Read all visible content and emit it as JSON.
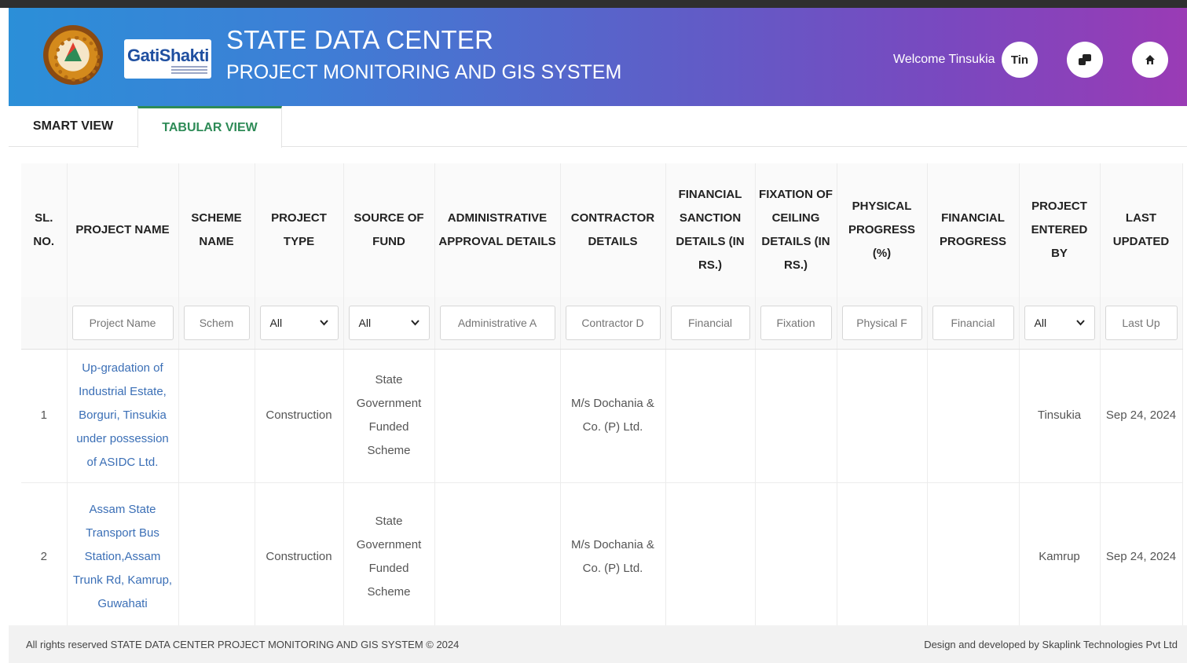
{
  "header": {
    "emblem_text": "ASIDC",
    "logo_text": "GatiShakti",
    "title": "STATE DATA CENTER",
    "subtitle": "PROJECT MONITORING AND GIS SYSTEM",
    "welcome": "Welcome Tinsukia",
    "avatar": "Tin",
    "icons": [
      "switch-icon",
      "home-icon"
    ]
  },
  "tabs": [
    {
      "label": "SMART VIEW",
      "active": false
    },
    {
      "label": "TABULAR VIEW",
      "active": true
    }
  ],
  "table": {
    "headers": [
      "SL. NO.",
      "PROJECT NAME",
      "SCHEME NAME",
      "PROJECT TYPE",
      "SOURCE OF FUND",
      "ADMINISTRATIVE APPROVAL DETAILS",
      "CONTRACTOR DETAILS",
      "FINANCIAL SANCTION DETAILS (IN RS.)",
      "FIXATION OF CEILING DETAILS (IN RS.)",
      "PHYSICAL PROGRESS (%)",
      "FINANCIAL PROGRESS",
      "PROJECT ENTERED BY",
      "LAST UPDATED"
    ],
    "filters": {
      "project_name": "Project Name",
      "scheme_name": "Schem",
      "project_type": "All",
      "source_of_fund": "All",
      "admin_approval": "Administrative A",
      "contractor": "Contractor D",
      "financial_sanction": "Financial",
      "fixation": "Fixation",
      "physical": "Physical F",
      "financial_progress": "Financial",
      "entered_by": "All",
      "last_updated": "Last Up"
    },
    "rows": [
      {
        "sl": "1",
        "project_name": "Up-gradation of Industrial Estate, Borguri, Tinsukia under possession of ASIDC Ltd.",
        "scheme_name": "",
        "project_type": "Construction",
        "source_of_fund": "State Government Funded Scheme",
        "admin_approval": "",
        "contractor": "M/s Dochania & Co. (P) Ltd.",
        "financial_sanction": "",
        "fixation": "",
        "physical": "",
        "financial_progress": "",
        "entered_by": "Tinsukia",
        "last_updated": "Sep 24, 2024"
      },
      {
        "sl": "2",
        "project_name": "Assam State Transport Bus Station,Assam Trunk Rd, Kamrup, Guwahati",
        "scheme_name": "",
        "project_type": "Construction",
        "source_of_fund": "State Government Funded Scheme",
        "admin_approval": "",
        "contractor": "M/s Dochania & Co. (P) Ltd.",
        "financial_sanction": "",
        "fixation": "",
        "physical": "",
        "financial_progress": "",
        "entered_by": "Kamrup",
        "last_updated": "Sep 24, 2024"
      }
    ]
  },
  "footer": {
    "left": "All rights reserved  STATE DATA CENTER PROJECT MONITORING AND GIS SYSTEM © 2024",
    "right": "Design and developed by Skaplink Technologies Pvt Ltd"
  }
}
